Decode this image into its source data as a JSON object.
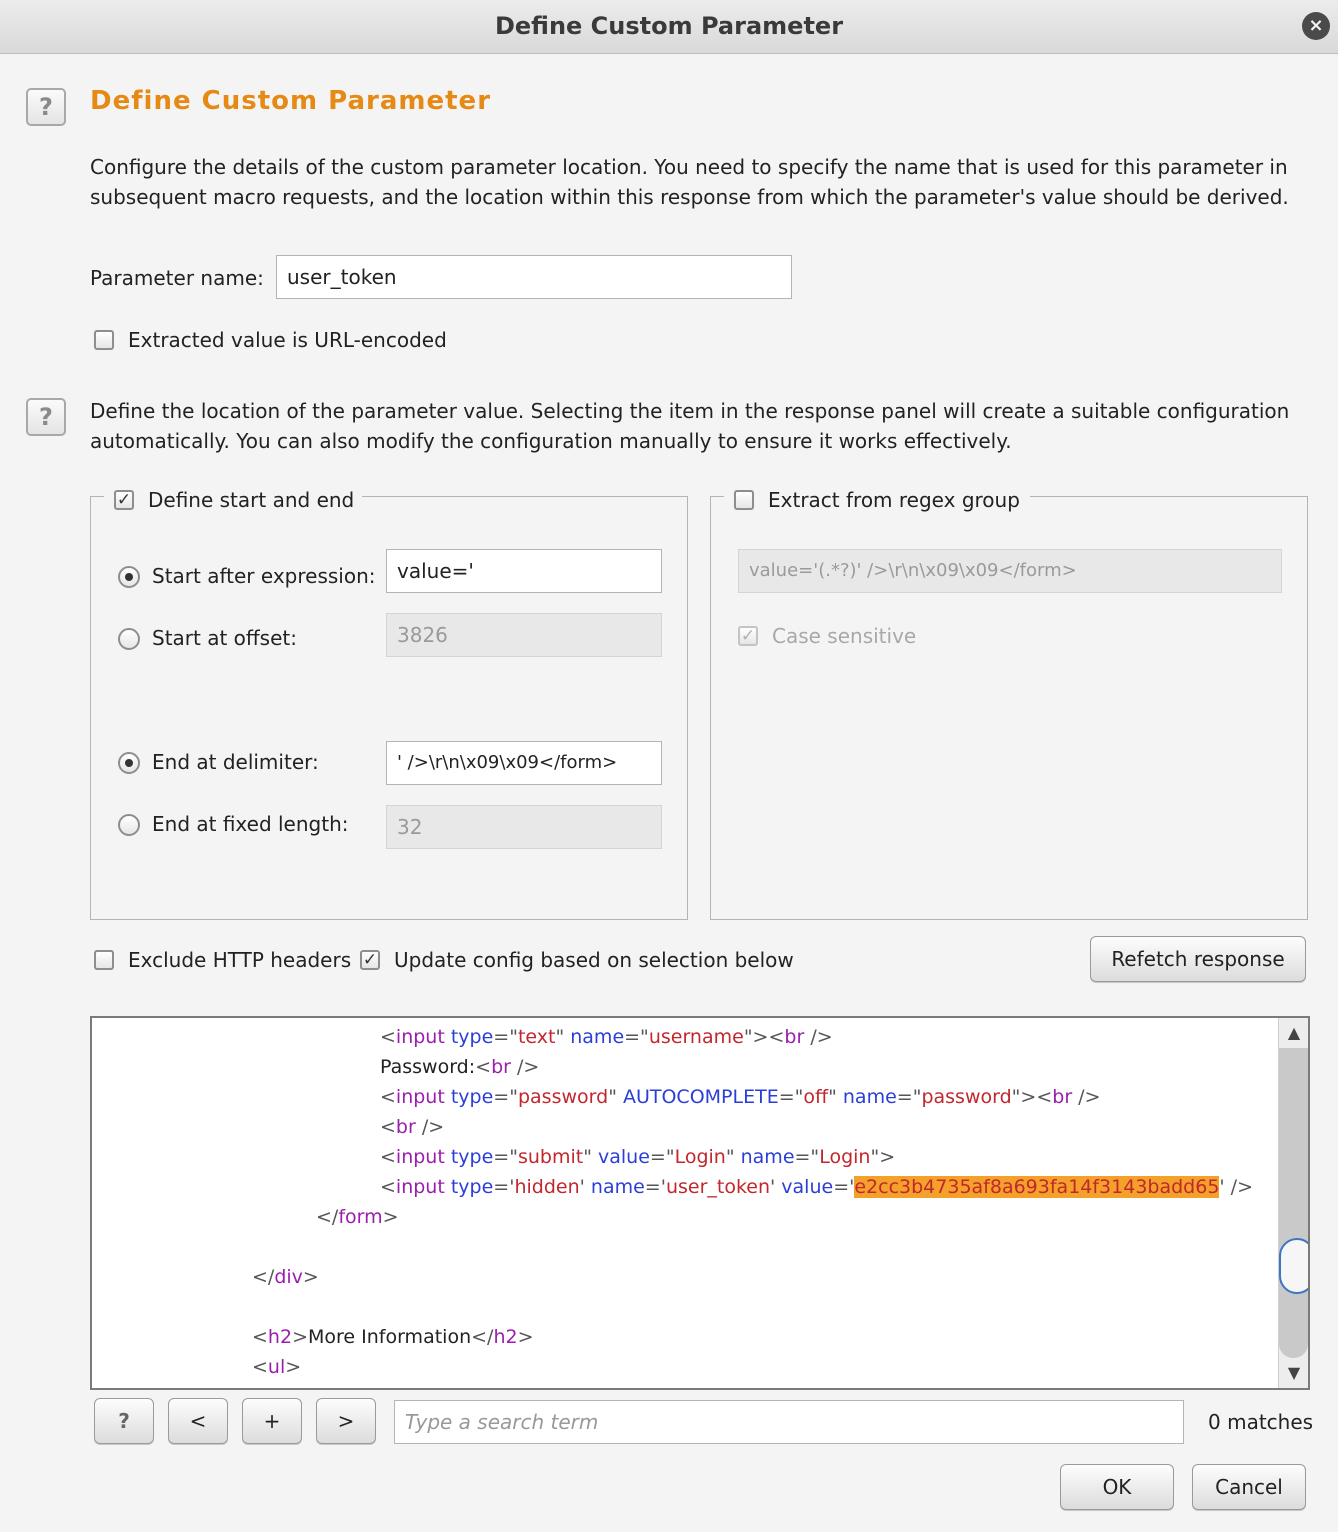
{
  "window": {
    "title": "Define Custom Parameter",
    "close_glyph": "×"
  },
  "header": {
    "title": "Define Custom Parameter",
    "help_glyph": "?"
  },
  "intro": "Configure the details of the custom parameter location. You need to specify the name that is used for this parameter in subsequent macro requests, and the location within this response from which the parameter's value should be derived.",
  "param_name": {
    "label": "Parameter name:",
    "value": "user_token"
  },
  "url_encoded": {
    "label": "Extracted value is URL-encoded",
    "checked": false
  },
  "location_desc": "Define the location of the parameter value. Selecting the item in the response panel will create a suitable configuration automatically. You can also modify the configuration manually to ensure it works effectively.",
  "start_end": {
    "label": "Define start and end",
    "checked": true,
    "start_after": {
      "label": "Start after expression:",
      "value": "value='",
      "selected": true
    },
    "start_offset": {
      "label": "Start at offset:",
      "value": "3826",
      "selected": false
    },
    "end_delim": {
      "label": "End at delimiter:",
      "value": "' />\\r\\n\\x09\\x09</form>",
      "selected": true
    },
    "end_fixed": {
      "label": "End at fixed length:",
      "value": "32",
      "selected": false
    }
  },
  "regex": {
    "label": "Extract from regex group",
    "checked": false,
    "value": "value='(.*?)' />\\r\\n\\x09\\x09</form>",
    "case_label": "Case sensitive",
    "case_checked": true
  },
  "options": {
    "exclude_headers": {
      "label": "Exclude HTTP headers",
      "checked": false
    },
    "update_config": {
      "label": "Update config based on selection below",
      "checked": true
    },
    "refetch": "Refetch response"
  },
  "check_glyph": "✓",
  "code_lines": [
    [
      {
        "t": "<",
        "c": "tk-br"
      },
      {
        "t": "input",
        "c": "tk-tag"
      },
      {
        "t": " ",
        "c": "tk-txt"
      },
      {
        "t": "type",
        "c": "tk-attr"
      },
      {
        "t": "=\"",
        "c": "tk-br"
      },
      {
        "t": "text",
        "c": "tk-val"
      },
      {
        "t": "\" ",
        "c": "tk-br"
      },
      {
        "t": "name",
        "c": "tk-attr"
      },
      {
        "t": "=\"",
        "c": "tk-br"
      },
      {
        "t": "username",
        "c": "tk-val"
      },
      {
        "t": "\"><",
        "c": "tk-br"
      },
      {
        "t": "br",
        "c": "tk-tag"
      },
      {
        "t": " />",
        "c": "tk-br"
      }
    ],
    [
      {
        "t": "Password:",
        "c": "tk-txt"
      },
      {
        "t": "<",
        "c": "tk-br"
      },
      {
        "t": "br",
        "c": "tk-tag"
      },
      {
        "t": " />",
        "c": "tk-br"
      }
    ],
    [
      {
        "t": "<",
        "c": "tk-br"
      },
      {
        "t": "input",
        "c": "tk-tag"
      },
      {
        "t": " ",
        "c": "tk-txt"
      },
      {
        "t": "type",
        "c": "tk-attr"
      },
      {
        "t": "=\"",
        "c": "tk-br"
      },
      {
        "t": "password",
        "c": "tk-val"
      },
      {
        "t": "\" ",
        "c": "tk-br"
      },
      {
        "t": "AUTOCOMPLETE",
        "c": "tk-attr"
      },
      {
        "t": "=\"",
        "c": "tk-br"
      },
      {
        "t": "off",
        "c": "tk-val"
      },
      {
        "t": "\" ",
        "c": "tk-br"
      },
      {
        "t": "name",
        "c": "tk-attr"
      },
      {
        "t": "=\"",
        "c": "tk-br"
      },
      {
        "t": "password",
        "c": "tk-val"
      },
      {
        "t": "\"><",
        "c": "tk-br"
      },
      {
        "t": "br",
        "c": "tk-tag"
      },
      {
        "t": " />",
        "c": "tk-br"
      }
    ],
    [
      {
        "t": "<",
        "c": "tk-br"
      },
      {
        "t": "br",
        "c": "tk-tag"
      },
      {
        "t": " />",
        "c": "tk-br"
      }
    ],
    [
      {
        "t": "<",
        "c": "tk-br"
      },
      {
        "t": "input",
        "c": "tk-tag"
      },
      {
        "t": " ",
        "c": "tk-txt"
      },
      {
        "t": "type",
        "c": "tk-attr"
      },
      {
        "t": "=\"",
        "c": "tk-br"
      },
      {
        "t": "submit",
        "c": "tk-val"
      },
      {
        "t": "\" ",
        "c": "tk-br"
      },
      {
        "t": "value",
        "c": "tk-attr"
      },
      {
        "t": "=\"",
        "c": "tk-br"
      },
      {
        "t": "Login",
        "c": "tk-val"
      },
      {
        "t": "\" ",
        "c": "tk-br"
      },
      {
        "t": "name",
        "c": "tk-attr"
      },
      {
        "t": "=\"",
        "c": "tk-br"
      },
      {
        "t": "Login",
        "c": "tk-val"
      },
      {
        "t": "\">",
        "c": "tk-br"
      }
    ],
    [
      {
        "t": "<",
        "c": "tk-br"
      },
      {
        "t": "input",
        "c": "tk-tag"
      },
      {
        "t": " ",
        "c": "tk-txt"
      },
      {
        "t": "type",
        "c": "tk-attr"
      },
      {
        "t": "='",
        "c": "tk-br"
      },
      {
        "t": "hidden",
        "c": "tk-val"
      },
      {
        "t": "' ",
        "c": "tk-br"
      },
      {
        "t": "name",
        "c": "tk-attr"
      },
      {
        "t": "='",
        "c": "tk-br"
      },
      {
        "t": "user_token",
        "c": "tk-val"
      },
      {
        "t": "' ",
        "c": "tk-br"
      },
      {
        "t": "value",
        "c": "tk-attr"
      },
      {
        "t": "='",
        "c": "tk-br"
      },
      {
        "t": "e2cc3b4735af8a693fa14f3143badd65",
        "c": "tk-hl"
      },
      {
        "t": "' />",
        "c": "tk-br"
      }
    ],
    [
      {
        "t": "</",
        "c": "tk-br"
      },
      {
        "t": "form",
        "c": "tk-tag"
      },
      {
        "t": ">",
        "c": "tk-br"
      }
    ],
    [],
    [
      {
        "t": "</",
        "c": "tk-br"
      },
      {
        "t": "div",
        "c": "tk-tag"
      },
      {
        "t": ">",
        "c": "tk-br"
      }
    ],
    [],
    [
      {
        "t": "<",
        "c": "tk-br"
      },
      {
        "t": "h2",
        "c": "tk-tag"
      },
      {
        "t": ">",
        "c": "tk-br"
      },
      {
        "t": "More Information",
        "c": "tk-txt"
      },
      {
        "t": "</",
        "c": "tk-br"
      },
      {
        "t": "h2",
        "c": "tk-tag"
      },
      {
        "t": ">",
        "c": "tk-br"
      }
    ],
    [
      {
        "t": "<",
        "c": "tk-br"
      },
      {
        "t": "ul",
        "c": "tk-tag"
      },
      {
        "t": ">",
        "c": "tk-br"
      }
    ]
  ],
  "scroll": {
    "up": "▲",
    "down": "▼"
  },
  "search": {
    "help": "?",
    "prev": "<",
    "add": "+",
    "next": ">",
    "placeholder": "Type a search term",
    "matches": "0 matches"
  },
  "footer": {
    "ok": "OK",
    "cancel": "Cancel"
  }
}
